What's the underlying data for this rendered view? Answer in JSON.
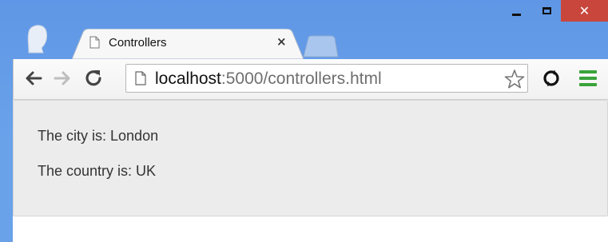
{
  "browser": {
    "tab": {
      "title": "Controllers",
      "close_glyph": "×",
      "icon": "page-icon"
    },
    "window_controls": {
      "close_glyph": "✕"
    },
    "address": {
      "host": "localhost",
      "rest": ":5000/controllers.html"
    },
    "icons": [
      "back-arrow-icon",
      "forward-arrow-icon",
      "reload-icon",
      "page-icon",
      "star-icon",
      "extension-icon",
      "menu-icon"
    ],
    "colors": {
      "frame": "#6aa2ea",
      "close_button": "#c8463c",
      "menu": "#3aa33a"
    }
  },
  "page": {
    "lines": [
      "The city is: London",
      "The country is: UK"
    ]
  }
}
